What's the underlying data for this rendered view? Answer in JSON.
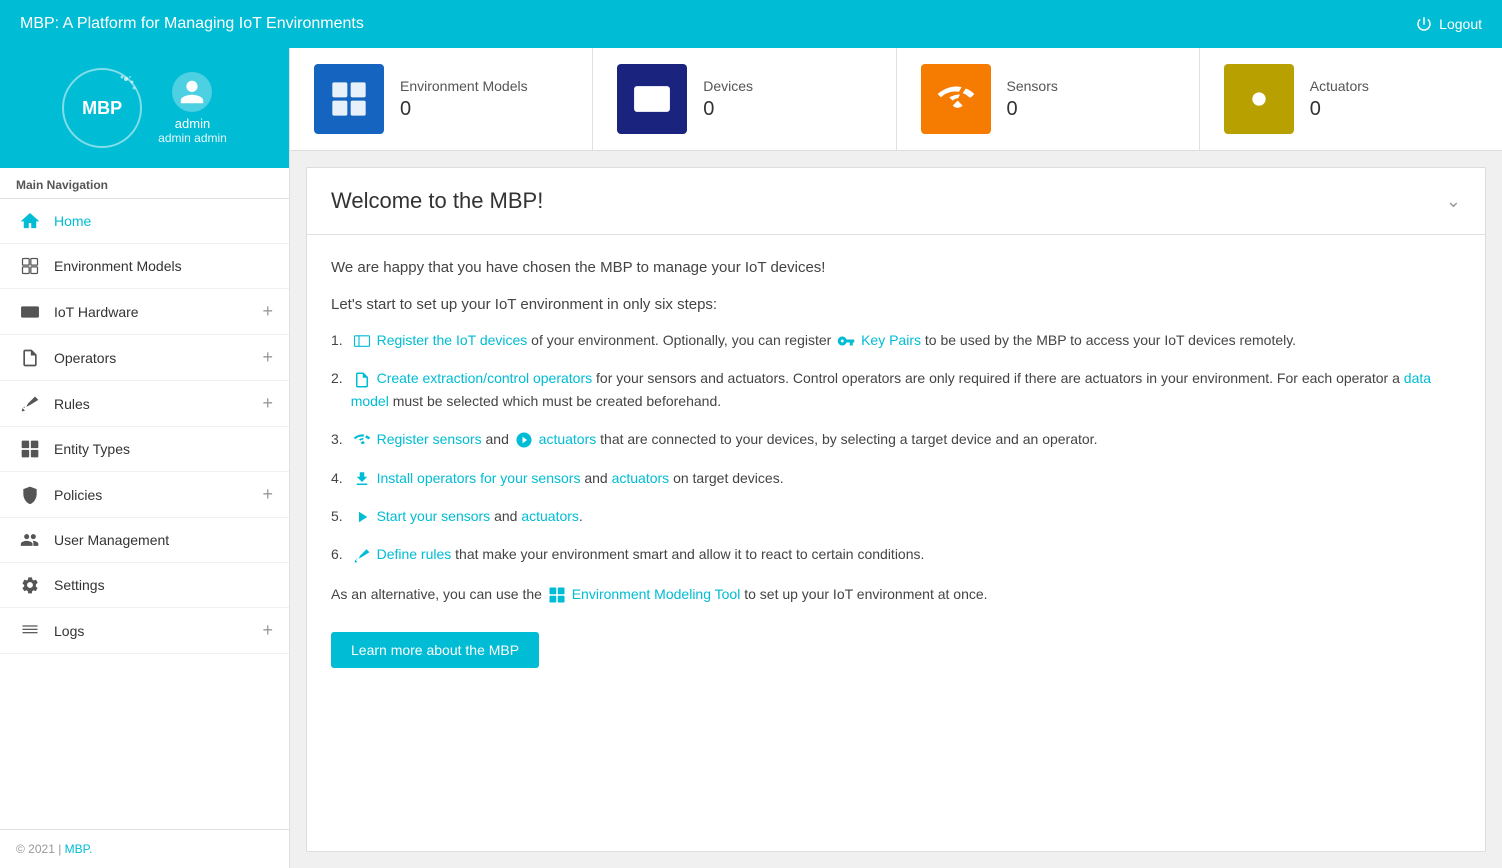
{
  "app": {
    "title": "MBP: A Platform for Managing IoT Environments",
    "logout_label": "Logout"
  },
  "sidebar": {
    "logo_text": "MBP",
    "admin_name": "admin",
    "admin_fullname": "admin admin",
    "nav_section_title": "Main Navigation",
    "items": [
      {
        "id": "home",
        "label": "Home",
        "active": true
      },
      {
        "id": "environment-models",
        "label": "Environment Models",
        "active": false
      },
      {
        "id": "iot-hardware",
        "label": "IoT Hardware",
        "active": false,
        "expandable": true
      },
      {
        "id": "operators",
        "label": "Operators",
        "active": false,
        "expandable": true
      },
      {
        "id": "rules",
        "label": "Rules",
        "active": false,
        "expandable": true
      },
      {
        "id": "entity-types",
        "label": "Entity Types",
        "active": false
      },
      {
        "id": "policies",
        "label": "Policies",
        "active": false,
        "expandable": true
      },
      {
        "id": "user-management",
        "label": "User Management",
        "active": false
      },
      {
        "id": "settings",
        "label": "Settings",
        "active": false
      },
      {
        "id": "logs",
        "label": "Logs",
        "active": false,
        "expandable": true
      }
    ],
    "footer_text": "© 2021 | ",
    "footer_link": "MBP."
  },
  "stats": [
    {
      "label": "Environment Models",
      "value": "0",
      "color": "#1565c0"
    },
    {
      "label": "Devices",
      "value": "0",
      "color": "#1a237e"
    },
    {
      "label": "Sensors",
      "value": "0",
      "color": "#f57c00"
    },
    {
      "label": "Actuators",
      "value": "0",
      "color": "#b8a000"
    }
  ],
  "welcome": {
    "title": "Welcome to the MBP!",
    "intro": "We are happy that you have chosen the MBP to manage your IoT devices!",
    "steps_intro": "Let's start to set up your IoT environment in only six steps:",
    "steps": [
      {
        "num": "1.",
        "before": "Register the IoT devices",
        "link1": "Register the IoT devices",
        "middle1": " of your environment. Optionally, you can register ",
        "link2": "Key Pairs",
        "after": " to be used by the MBP to access your IoT devices remotely."
      },
      {
        "num": "2.",
        "link1": "Create extraction/control operators",
        "middle1": " for your sensors and actuators. Control operators are only required if there are actuators in your environment. For each operator a ",
        "link2": "data model",
        "after": " must be selected which must be created beforehand."
      },
      {
        "num": "3.",
        "link1": "Register sensors",
        "middle1": " and ",
        "link2": "actuators",
        "after": " that are connected to your devices, by selecting a target device and an operator."
      },
      {
        "num": "4.",
        "link1": "Install operators for your sensors",
        "middle1": " and ",
        "link2": "actuators",
        "after": " on target devices."
      },
      {
        "num": "5.",
        "link1": "Start your sensors",
        "middle1": " and ",
        "link2": "actuators",
        "after": "."
      },
      {
        "num": "6.",
        "link1": "Define rules",
        "after": " that make your environment smart and allow it to react to certain conditions."
      }
    ],
    "alternative_before": "As an alternative, you can use the ",
    "alternative_link": "Environment Modeling Tool",
    "alternative_after": " to set up your IoT environment at once.",
    "learn_btn": "Learn more about the MBP"
  }
}
